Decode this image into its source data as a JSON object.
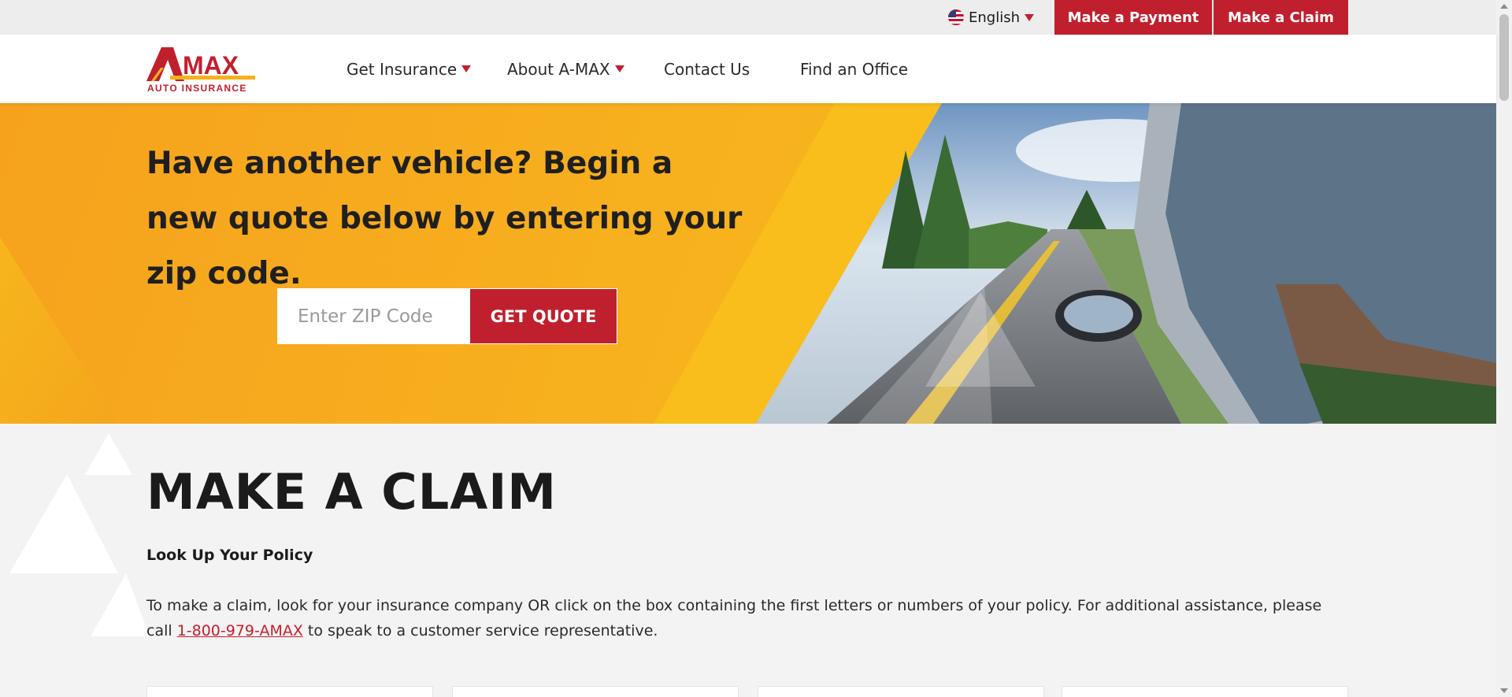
{
  "utility": {
    "language": "English",
    "payment_label": "Make a Payment",
    "claim_label": "Make a Claim"
  },
  "logo": {
    "brand": "A·MAX",
    "tagline": "AUTO INSURANCE"
  },
  "nav": {
    "items": [
      {
        "label": "Get Insurance",
        "has_dropdown": true
      },
      {
        "label": "About A-MAX",
        "has_dropdown": true
      },
      {
        "label": "Contact Us",
        "has_dropdown": false
      },
      {
        "label": "Find an Office",
        "has_dropdown": false
      }
    ]
  },
  "hero": {
    "title": "Have another vehicle? Begin a new quote below by entering your zip code.",
    "zip_placeholder": "Enter ZIP Code",
    "quote_button": "GET QUOTE"
  },
  "claim": {
    "title": "MAKE A CLAIM",
    "subtitle": "Look Up Your Policy",
    "body_before": "To make a claim, look for your insurance company OR click on the box containing the first letters or numbers of your policy. For additional assistance, please call ",
    "phone": "1-800-979-AMAX",
    "body_after": " to speak to a customer service representative."
  },
  "colors": {
    "brand_red": "#c0202e",
    "hero_yellow": "#f7b11e",
    "background": "#f3f3f3"
  }
}
